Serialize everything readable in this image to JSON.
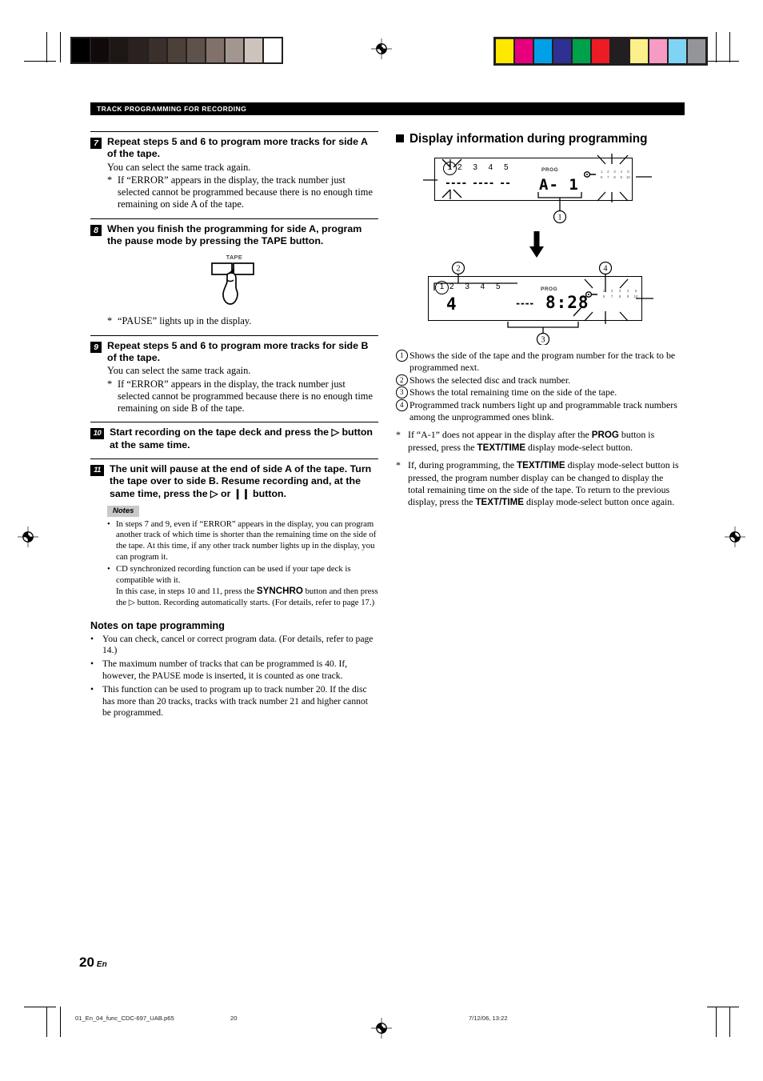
{
  "section_bar": "TRACK PROGRAMMING FOR RECORDING",
  "left_column": {
    "steps": [
      {
        "number": "7",
        "title": "Repeat steps 5 and 6 to program more tracks for side A of the tape.",
        "body": "You can select the same track again.",
        "star_marker": "*",
        "star_text": "If “ERROR” appears in the display, the track number just selected cannot be programmed because there is no enough time remaining on side A of the tape."
      },
      {
        "number": "8",
        "title": "When you finish the programming for side A, program the pause mode by pressing the TAPE button.",
        "figure_label": "TAPE",
        "star_marker": "*",
        "star_text": "“PAUSE” lights up in the display."
      },
      {
        "number": "9",
        "title": "Repeat steps 5 and 6 to program more tracks for side B of the tape.",
        "body": "You can select the same track again.",
        "star_marker": "*",
        "star_text": "If “ERROR” appears in the display, the track number just selected cannot be programmed because there is no enough time remaining on side B of the tape."
      },
      {
        "number": "10",
        "title_part1": "Start recording on the tape deck and press the ",
        "play_icon": "▷",
        "title_part2": " button at the same time."
      },
      {
        "number": "11",
        "title_part1": "The unit will pause at the end of side A of the tape. Turn the tape over to side B. Resume recording and, at the same time, press the ",
        "play_icon": "▷",
        "title_mid": " or ",
        "pause_icon": "❙❙",
        "title_part2": " button."
      }
    ],
    "notes_label": "Notes",
    "notes": [
      "In steps 7 and 9, even if “ERROR” appears in the display, you can program another track of which time is shorter than the remaining time on the side of the tape. At this time, if any other track number lights up in the display, you can program it.",
      "CD synchronized recording function can be used if your tape deck is compatible with it."
    ],
    "note_synchro_line1_a": "In this case, in steps 10 and 11, press the ",
    "note_synchro_bold": "SYNCHRO",
    "note_synchro_line1_b": " button and then press the ",
    "note_synchro_icon": "▷",
    "note_synchro_line1_c": " button. Recording automatically starts. (For details, refer to page 17.)",
    "subhead": "Notes on tape programming",
    "tape_notes": [
      "You can check, cancel or correct program data.  (For details, refer to page 14.)",
      "The maximum number of tracks that can be programmed is 40. If, however, the PAUSE mode is inserted, it is counted as one track.",
      "This function can be used to program up to track number 20. If the disc has more than 20 tracks, tracks with track number 21 and higher cannot be programmed."
    ],
    "bullet_char": "•"
  },
  "right_column": {
    "heading": "Display information during programming",
    "display_1": {
      "disc_numbers": "2  3  4  5",
      "selected_disc": "1",
      "dashes": "---- ----  --",
      "prog_label": "PROG",
      "main_segment": "A- 1",
      "track_grid_row1": [
        "1",
        "2",
        "3",
        "4",
        "5"
      ],
      "track_grid_row2": [
        "6",
        "7",
        "8",
        "9",
        "10"
      ],
      "callout": "1"
    },
    "display_2": {
      "disc_numbers": "2  3  4  5",
      "selected_disc": "1",
      "track_number": "4",
      "prog_label": "PROG",
      "time_dashes": "----",
      "time_value": "8:28",
      "track_grid_row1": [
        "1",
        "2",
        "3",
        "4",
        "5"
      ],
      "track_grid_row2": [
        "6",
        "7",
        "8",
        "9",
        "10"
      ],
      "callout_top_left": "2",
      "callout_top_right": "4",
      "callout_bottom": "3"
    },
    "legend": [
      {
        "num": "1",
        "text": "Shows the side of the tape and the program number for the track to be programmed next."
      },
      {
        "num": "2",
        "text": "Shows the selected disc and track number."
      },
      {
        "num": "3",
        "text": "Shows the total remaining time on the side of the tape."
      },
      {
        "num": "4",
        "text": "Programmed track numbers light up and programmable track numbers among the unprogrammed ones blink."
      }
    ],
    "footnotes": [
      {
        "marker": "*",
        "a": "If “A-1” does not appear in the display after the ",
        "b1": "PROG",
        "c": " button is pressed, press the ",
        "b2": "TEXT/TIME",
        "d": " display mode-select button."
      },
      {
        "marker": "*",
        "a": "If, during programming, the ",
        "b1": "TEXT/TIME",
        "c": " display mode-select button is pressed, the program number display can be changed to display the total remaining time on the side of the tape.  To return to the previous display, press the ",
        "b2": "TEXT/TIME",
        "d": " display mode-select button once again."
      }
    ]
  },
  "page_number": "20",
  "page_lang": "En",
  "production_footer": {
    "filename": "01_En_04_func_CDC-697_UAB.p65",
    "page": "20",
    "timestamp": "7/12/06, 13:22"
  },
  "print_marks": {
    "gray_wedge": [
      "#000000",
      "#100b0a",
      "#1d1614",
      "#2b221f",
      "#3a2f2b",
      "#4c4039",
      "#5f524a",
      "#80726b",
      "#a3968f",
      "#cdc3bd",
      "#ffffff"
    ],
    "color_bar": [
      "#ffe800",
      "#e6007e",
      "#00a0e9",
      "#2e3192",
      "#00a14b",
      "#ed1c24",
      "#231f20",
      "#fdf08a",
      "#f59bc4",
      "#7fd4f5",
      "#939598"
    ]
  }
}
